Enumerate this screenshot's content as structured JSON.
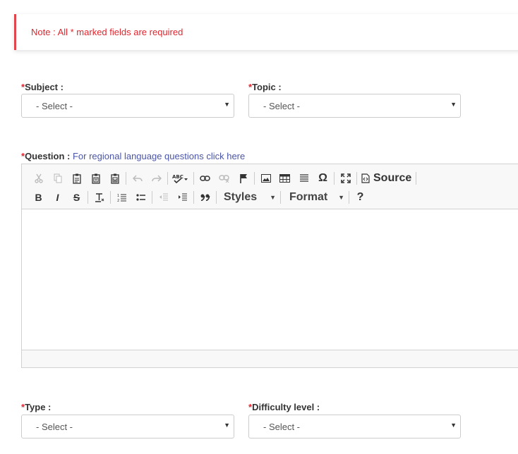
{
  "note": {
    "text": "Note : All * marked fields are required"
  },
  "fields": {
    "subject": {
      "req": "*",
      "label": "Subject :",
      "value": "- Select -"
    },
    "topic": {
      "req": "*",
      "label": "Topic :",
      "value": "- Select -"
    },
    "question": {
      "req": "*",
      "label": "Question :",
      "link": "For regional language questions click here"
    },
    "type": {
      "req": "*",
      "label": "Type :",
      "value": "- Select -"
    },
    "difficulty": {
      "req": "*",
      "label": "Difficulty level :",
      "value": "- Select -"
    }
  },
  "editor": {
    "source_label": "Source",
    "styles_label": "Styles",
    "format_label": "Format",
    "help_label": "?",
    "toolbar_row1": [
      "cut-icon",
      "copy-icon",
      "paste-icon",
      "paste-text-icon",
      "paste-word-icon",
      "undo-icon",
      "redo-icon",
      "spellcheck-icon",
      "link-icon",
      "unlink-icon",
      "anchor-icon",
      "image-icon",
      "table-icon",
      "horizontal-line-icon",
      "special-char-icon",
      "maximize-icon",
      "source-icon"
    ],
    "toolbar_row2": [
      "bold-icon",
      "italic-icon",
      "strike-icon",
      "remove-format-icon",
      "numbered-list-icon",
      "bulleted-list-icon",
      "outdent-icon",
      "indent-icon",
      "blockquote-icon"
    ],
    "glyphs": {
      "bold": "B",
      "italic": "I",
      "strike": "S",
      "special_char": "Ω",
      "abc": "ABC"
    }
  },
  "colors": {
    "required": "#e0262e",
    "link": "#4a55a8",
    "note_border": "#e0454b"
  }
}
